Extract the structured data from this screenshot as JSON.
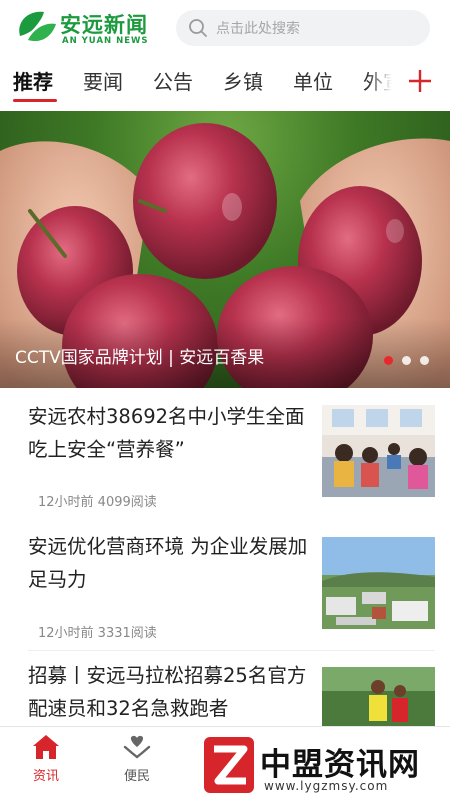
{
  "colors": {
    "brand_green": "#1c9a3e",
    "accent_red": "#d7262b",
    "text": "#222222",
    "meta": "#888888"
  },
  "header": {
    "logo_title": "安远新闻",
    "logo_subtitle": "AN YUAN NEWS",
    "logo_icon": "leaf-logo-icon",
    "search_placeholder": "点击此处搜索",
    "search_icon": "search-icon"
  },
  "tabs": [
    {
      "label": "推荐",
      "active": true
    },
    {
      "label": "要闻",
      "active": false
    },
    {
      "label": "公告",
      "active": false
    },
    {
      "label": "乡镇",
      "active": false
    },
    {
      "label": "单位",
      "active": false
    },
    {
      "label": "外宣",
      "active": false
    }
  ],
  "tabs_add_icon": "plus-icon",
  "banner": {
    "caption": "CCTV国家品牌计划 | 安远百香果",
    "slides_total": 3,
    "active_slide": 1
  },
  "news": [
    {
      "title": "安远农村38692名中小学生全面吃上安全“营养餐”",
      "meta": "12小时前 4099阅读",
      "thumb": "school-lunch-photo"
    },
    {
      "title": "安远优化营商环境 为企业发展加足马力",
      "meta": "12小时前 3331阅读",
      "thumb": "town-aerial-photo"
    },
    {
      "title": "招募丨安远马拉松招募25名官方配速员和32名急救跑者",
      "meta": "",
      "thumb": "runners-photo"
    }
  ],
  "bottom_nav": [
    {
      "label": "资讯",
      "icon": "home-icon",
      "active": true
    },
    {
      "label": "便民",
      "icon": "heart-hands-icon",
      "active": false
    }
  ],
  "watermark": {
    "text": "中盟资讯网",
    "url": "www.lygzmsy.com"
  }
}
